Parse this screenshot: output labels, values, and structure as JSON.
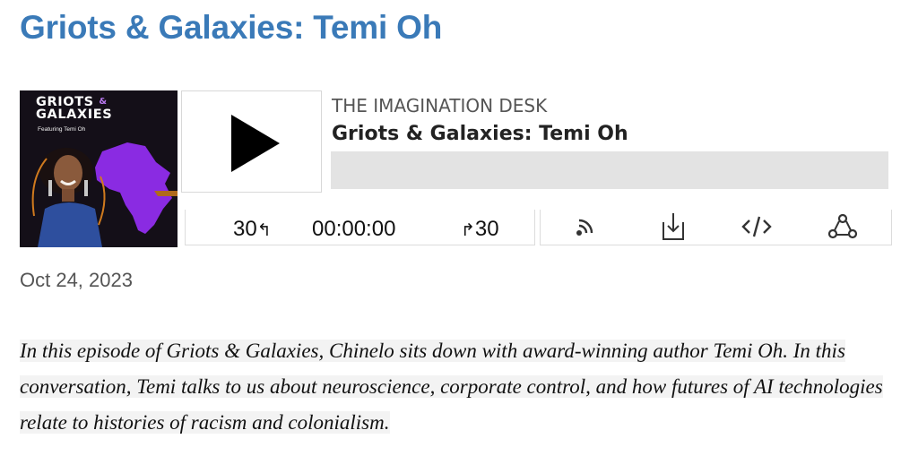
{
  "page": {
    "title": "Griots & Galaxies: Temi Oh",
    "date": "Oct 24, 2023",
    "description": "In this episode of Griots & Galaxies, Chinelo sits down with award-winning author Temi Oh. In this conversation, Temi talks to us about neuroscience, corporate control, and how futures of AI technologies relate to histories of racism and colonialism."
  },
  "player": {
    "cover": {
      "title_line1": "GRIOTS",
      "title_amp": "&",
      "title_line2": "GALAXIES",
      "subtitle": "Featuring Temi Oh"
    },
    "show_name": "THE IMAGINATION DESK",
    "episode_title": "Griots & Galaxies: Temi Oh",
    "progress_fraction": 0,
    "play_icon": "play-icon",
    "rewind": {
      "label": "30",
      "arrow": "↰",
      "icon": "rewind-30-icon"
    },
    "current_time": "00:00:00",
    "forward": {
      "label": "30",
      "arrow": "↱",
      "icon": "forward-30-icon"
    },
    "actions": [
      {
        "name": "rss",
        "icon": "rss-icon"
      },
      {
        "name": "download",
        "icon": "download-icon"
      },
      {
        "name": "embed",
        "icon": "embed-code-icon"
      },
      {
        "name": "share",
        "icon": "share-icon"
      }
    ]
  },
  "colors": {
    "title": "#3a7ab8",
    "progress_track": "#e3e3e3",
    "cover_accent": "#8a2be2",
    "description_highlight": "#f3f3f3"
  }
}
